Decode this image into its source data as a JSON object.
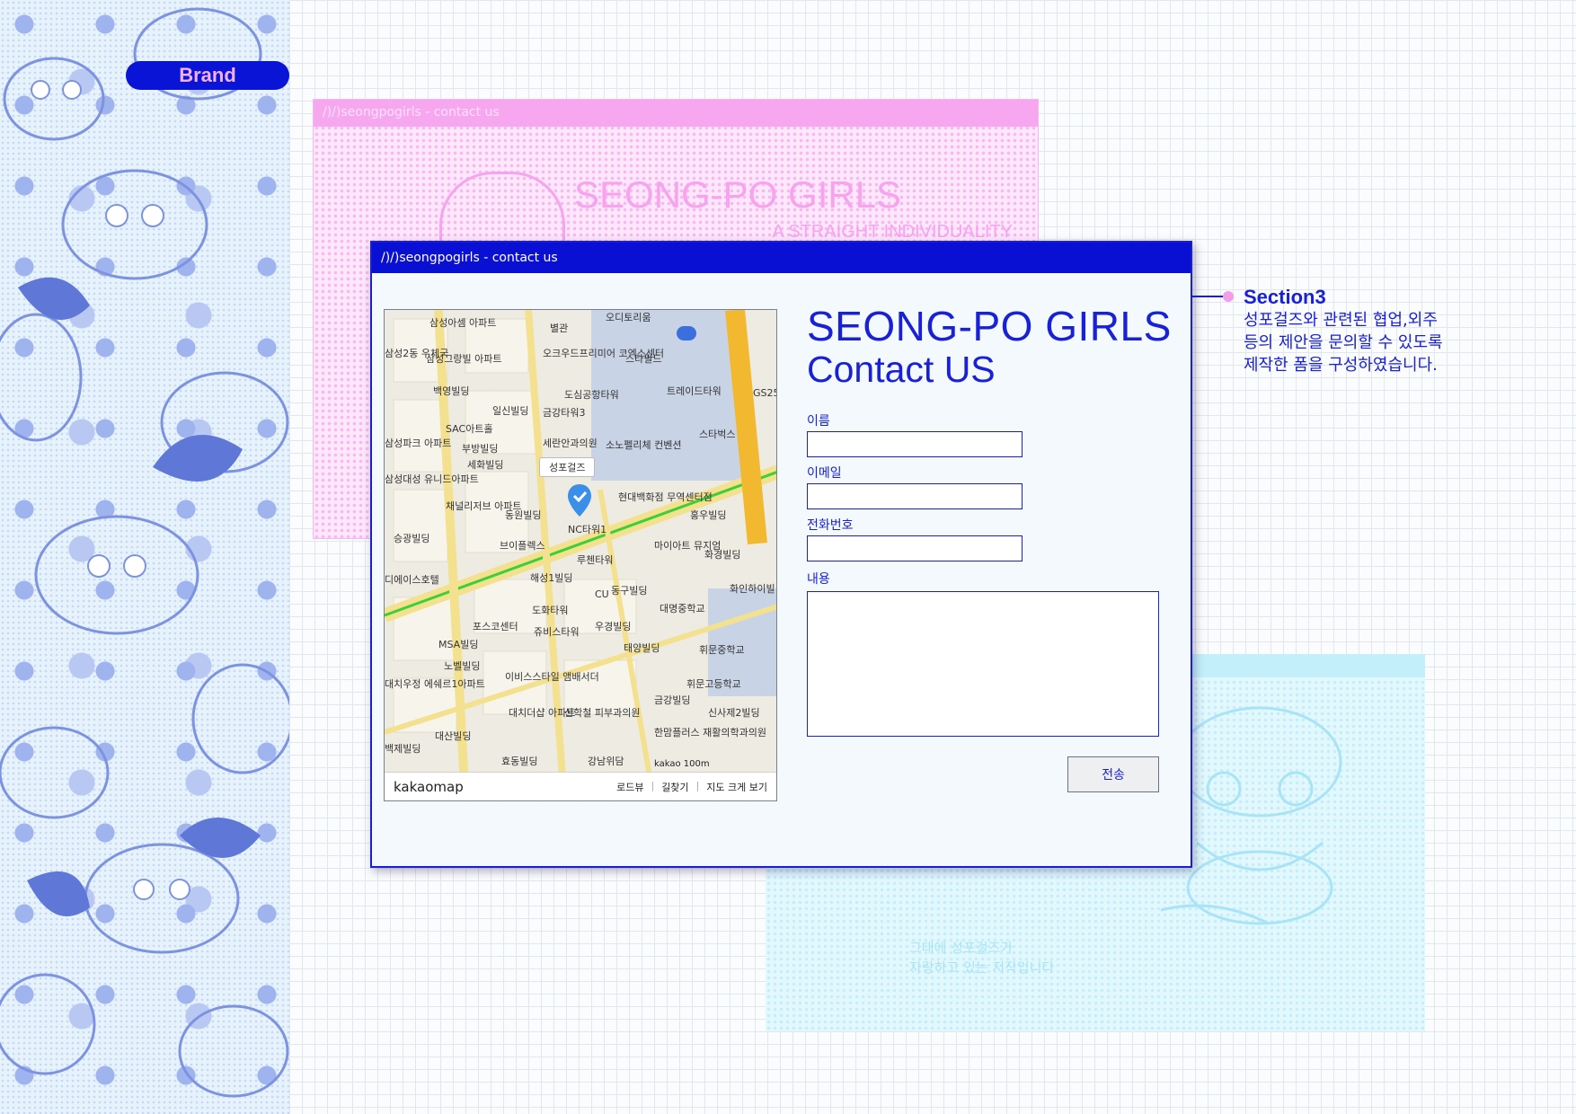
{
  "brand_label": "Brand",
  "back_windows": {
    "pink": {
      "title": "/)/)seongpogirls - contact us",
      "heading": "SEONG-PO GIRLS",
      "subheading": "A STRAIGHT INDIVIDUALITY"
    },
    "cyan": {
      "line1": "그대에 성포걸즈가",
      "line2": "자랑하고 있는 저작입니다"
    }
  },
  "window": {
    "title": "/)/)seongpogirls - contact us",
    "heading_line1": "SEONG-PO GIRLS",
    "heading_line2": "Contact US"
  },
  "map": {
    "brand": "kakaomap",
    "pin_label": "성포걸즈",
    "footer_links": [
      "로드뷰",
      "길찾기",
      "지도 크게 보기"
    ],
    "scale_text": "kakao 100m",
    "labels": [
      "삼성아셈 아파트",
      "별관",
      "오디토리움",
      "삼성2동 우체국",
      "삼성그랑빌 아파트",
      "오크우드프리미어 코엑스센터",
      "스타필드",
      "백영빌딩",
      "도심공항타워",
      "트레이드타워",
      "GS25",
      "일신빌딩",
      "금강타워3",
      "SAC아트홀",
      "세란안과의원",
      "소노펠리체 컨벤션",
      "스타벅스",
      "삼성파크 아파트",
      "부방빌딩",
      "세화빌딩",
      "삼성대성 유니드아파트",
      "현대백화점 무역센터점",
      "채널리저브 아파트",
      "동원빌딩",
      "NC타워1",
      "홍우빌딩",
      "승광빌딩",
      "브이플렉스",
      "루첸타워",
      "마이아트 뮤지엄",
      "화경빌딩",
      "디에이스호텔",
      "해성1빌딩",
      "CU",
      "동구빌딩",
      "대명중학교",
      "화인하이빌 아파트",
      "포스코센터",
      "도화타워",
      "우경빌딩",
      "쥬비스타워",
      "MSA빌딩",
      "태양빌딩",
      "휘문중학교",
      "노벨빌딩",
      "대치우정 에쉐르1아파트",
      "이비스스타일 앰배서더",
      "휘문고등학교",
      "금강빌딩",
      "대치더샵 아파트",
      "신학철 피부과의원",
      "신사제2빌딩",
      "대산빌딩",
      "한맘플러스 재활의학과의원",
      "백제빌딩",
      "효동빌딩",
      "강남위담"
    ]
  },
  "form": {
    "name_label": "이름",
    "email_label": "이메일",
    "phone_label": "전화번호",
    "content_label": "내용",
    "submit_label": "전송"
  },
  "annotation": {
    "title": "Section3",
    "body": "성포걸즈와 관련된 협업,외주 등의 제안을 문의할 수 있도록 제작한 폼을 구성하였습니다."
  },
  "colors": {
    "accent": "#1820d8",
    "pink": "#f7a6f0",
    "cyan": "#c3effb",
    "pin": "#3b8fe8"
  },
  "icons": [
    "location-pin-icon",
    "kakaomap-logo"
  ]
}
